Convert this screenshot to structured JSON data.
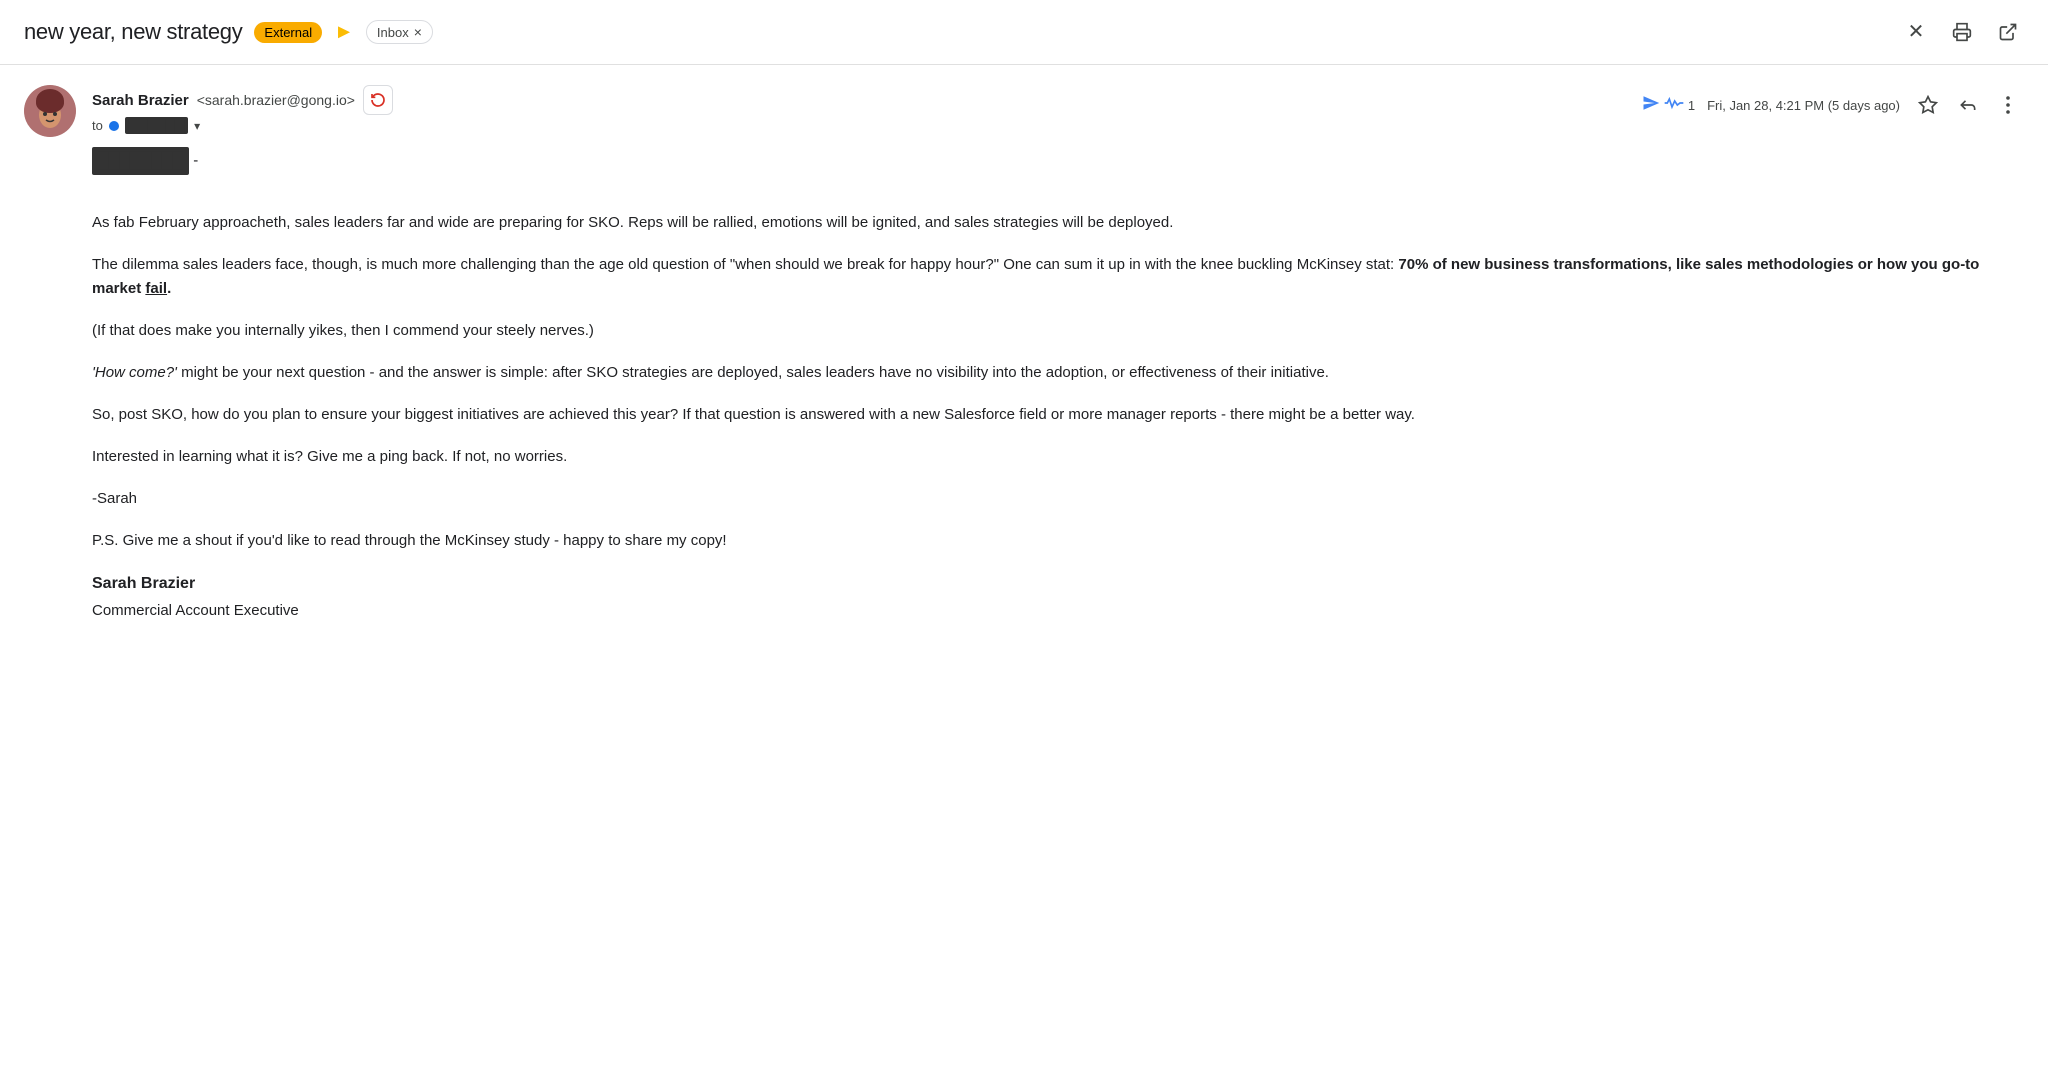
{
  "header": {
    "subject": "new year, new strategy",
    "badge_external": "External",
    "badge_inbox": "Inbox",
    "badge_inbox_close": "×",
    "arrow_symbol": "▶",
    "close_icon": "✕",
    "print_icon": "🖨",
    "popout_icon": "⤢"
  },
  "sender": {
    "name": "Sarah Brazier",
    "email": "<sarah.brazier@gong.io>",
    "to_label": "to",
    "to_recipient_redacted": "████████",
    "chevron": "▾",
    "date": "Fri, Jan 28, 4:21 PM (5 days ago)",
    "gong_count": "1",
    "star_icon": "☆",
    "reply_icon": "↩",
    "more_icon": "⋮",
    "action_icon_label": "Add to contacts"
  },
  "body": {
    "redacted_greeting": "████████",
    "separator": "-",
    "paragraph1": "As fab February approacheth, sales leaders far and wide are preparing for SKO. Reps will be rallied, emotions will be ignited, and sales strategies will be deployed.",
    "paragraph2_pre": "The dilemma sales leaders face, though, is much more challenging than the age old question of \"when should we break for happy hour?\" One can sum it up in with the knee buckling McKinsey stat: ",
    "paragraph2_bold": "70% of new business transformations, like sales methodologies or how you go-to market ",
    "paragraph2_bold_underline": "fail",
    "paragraph2_end": ".",
    "paragraph3": "(If that does make you internally yikes, then I commend your steely nerves.)",
    "paragraph4_italic": "'How come?'",
    "paragraph4_rest": " might be your next question - and the answer is simple: after SKO strategies are deployed, sales leaders have no visibility into the adoption, or effectiveness of their initiative.",
    "paragraph5": "So, post SKO, how do you plan to ensure your biggest initiatives are achieved this year? If that question is answered with a new Salesforce field or more manager reports - there might be a better way.",
    "paragraph6": "Interested in learning what it is? Give me a ping back. If not, no worries.",
    "signature_closing": "-Sarah",
    "ps": "P.S. Give me a shout if you'd like to read through the McKinsey study - happy to share my copy!",
    "signature_name": "Sarah Brazier",
    "signature_title": "Commercial Account Executive"
  }
}
